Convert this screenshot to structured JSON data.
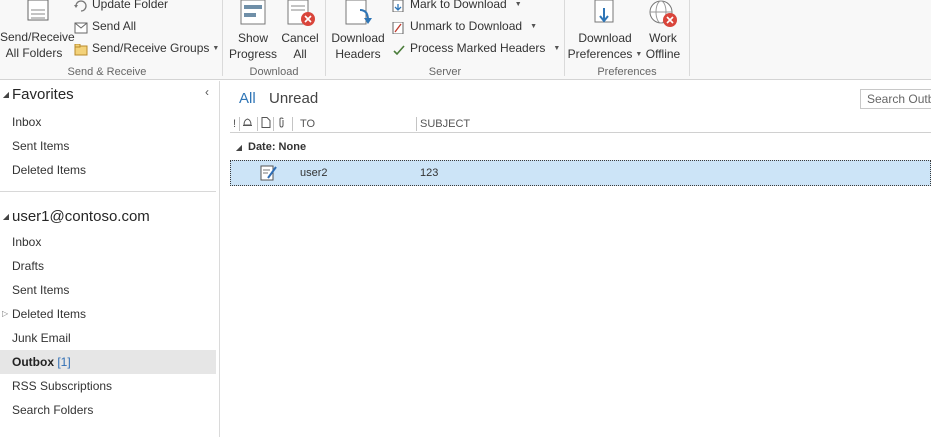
{
  "ribbon": {
    "send_receive": {
      "send_receive_all_line1": "Send/Receive",
      "send_receive_all_line2": "All Folders",
      "update_folder": "Update Folder",
      "send_all": "Send All",
      "send_receive_groups": "Send/Receive Groups",
      "group_label": "Send & Receive"
    },
    "download": {
      "show_progress_line1": "Show",
      "show_progress_line2": "Progress",
      "cancel_all_line1": "Cancel",
      "cancel_all_line2": "All",
      "group_label": "Download"
    },
    "server": {
      "download_headers_line1": "Download",
      "download_headers_line2": "Headers",
      "mark_to_download": "Mark to Download",
      "unmark_to_download": "Unmark to Download",
      "process_marked_headers": "Process Marked Headers",
      "group_label": "Server"
    },
    "preferences": {
      "download_preferences_line1": "Download",
      "download_preferences_line2": "Preferences",
      "work_offline_line1": "Work",
      "work_offline_line2": "Offline",
      "group_label": "Preferences"
    }
  },
  "folder_pane": {
    "favorites_header": "Favorites",
    "favorites": [
      {
        "label": "Inbox"
      },
      {
        "label": "Sent Items"
      },
      {
        "label": "Deleted Items"
      }
    ],
    "account_header": "user1@contoso.com",
    "folders": [
      {
        "label": "Inbox"
      },
      {
        "label": "Drafts"
      },
      {
        "label": "Sent Items"
      },
      {
        "label": "Deleted Items"
      },
      {
        "label": "Junk Email"
      },
      {
        "label": "Outbox",
        "count": "[1]"
      },
      {
        "label": "RSS Subscriptions"
      },
      {
        "label": "Search Folders"
      }
    ]
  },
  "message_list": {
    "filter_all": "All",
    "filter_unread": "Unread",
    "search_placeholder": "Search Outb",
    "columns": {
      "importance": "!",
      "to": "TO",
      "subject": "SUBJECT"
    },
    "group_header": "Date: None",
    "messages": [
      {
        "to": "user2",
        "subject": "123"
      }
    ]
  },
  "colors": {
    "accent": "#2e75b6",
    "selection": "#cce4f7",
    "ribbon_bg": "#f8f8f8",
    "selected_folder_bg": "#e6e6e6"
  }
}
